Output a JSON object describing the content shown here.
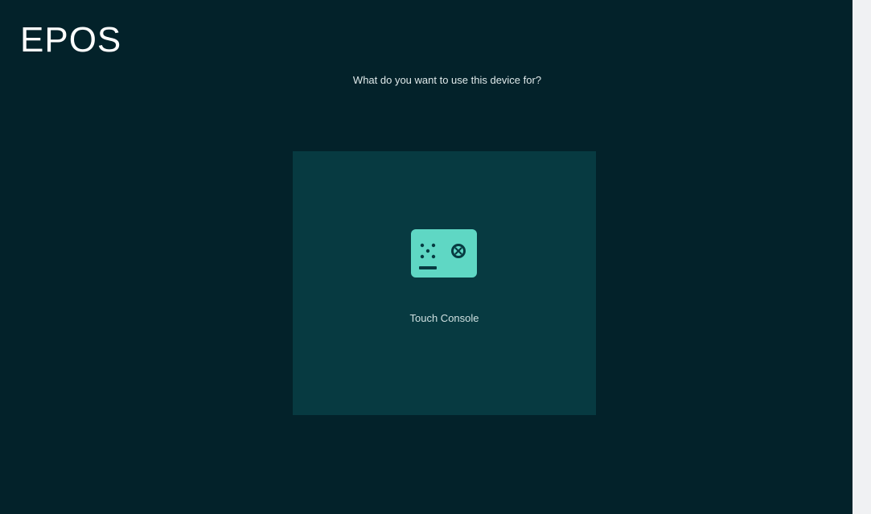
{
  "app": {
    "brand": "EPOS"
  },
  "setup": {
    "question": "What do you want to use this device for?",
    "options": [
      {
        "label": "Touch Console",
        "icon": "touch-console-icon",
        "selected": false
      }
    ]
  },
  "colors": {
    "background": "#03222a",
    "card": "#073a41",
    "icon_fill": "#5fd7c4",
    "text": "#dfe9ea"
  }
}
